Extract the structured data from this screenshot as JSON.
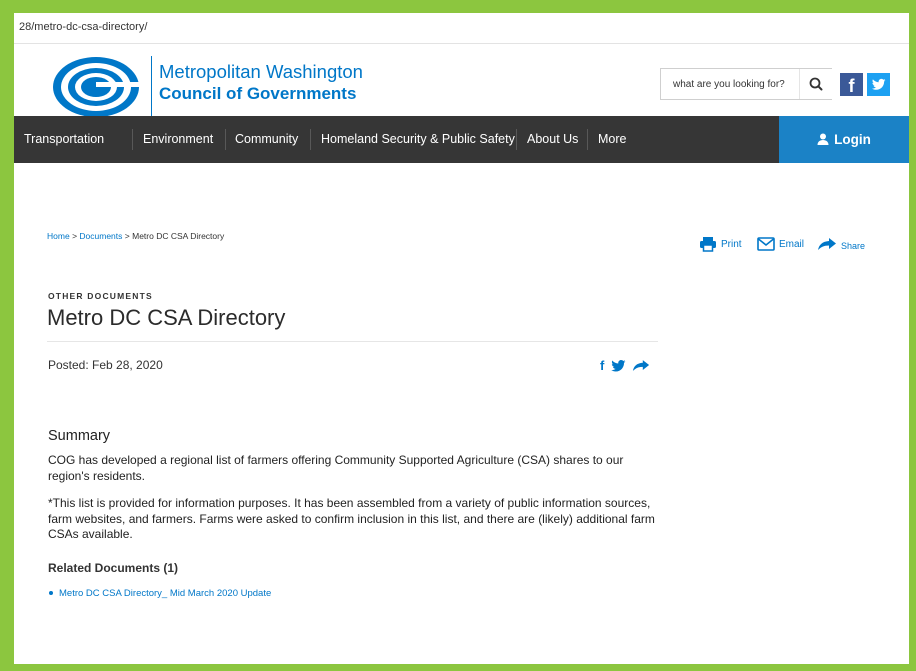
{
  "browser": {
    "url": "28/metro-dc-csa-directory/"
  },
  "header": {
    "logo_line1": "Metropolitan Washington",
    "logo_line2": "Council of Governments",
    "search_placeholder": "what are you looking for?"
  },
  "nav": {
    "items": [
      "Transportation",
      "Environment",
      "Community",
      "Homeland Security & Public Safety",
      "About Us",
      "More"
    ],
    "login": "Login"
  },
  "breadcrumb": {
    "home": "Home",
    "sep": ">",
    "documents": "Documents",
    "current": "Metro DC CSA Directory"
  },
  "tools": {
    "print": "Print",
    "email": "Email",
    "share": "Share"
  },
  "document": {
    "category": "OTHER DOCUMENTS",
    "title": "Metro DC CSA Directory",
    "posted": "Posted: Feb 28, 2020",
    "summary_heading": "Summary",
    "paragraphs": [
      "COG has developed a regional list of farmers offering Community Supported Agriculture (CSA) shares to our region's residents.",
      "*This list is provided for information purposes. It has been assembled from a variety of public information sources, farm websites, and farmers. Farms were asked to confirm inclusion in this list, and there are (likely) additional farm CSAs available."
    ],
    "related_heading": "Related Documents (1)",
    "related": [
      "Metro DC CSA Directory_ Mid March 2020 Update"
    ]
  },
  "colors": {
    "frame": "#8cc63f",
    "brand_blue": "#0077c8",
    "nav_bg": "#363636",
    "login_bg": "#1b82c6",
    "facebook": "#3b5998",
    "twitter": "#1da1f2"
  }
}
